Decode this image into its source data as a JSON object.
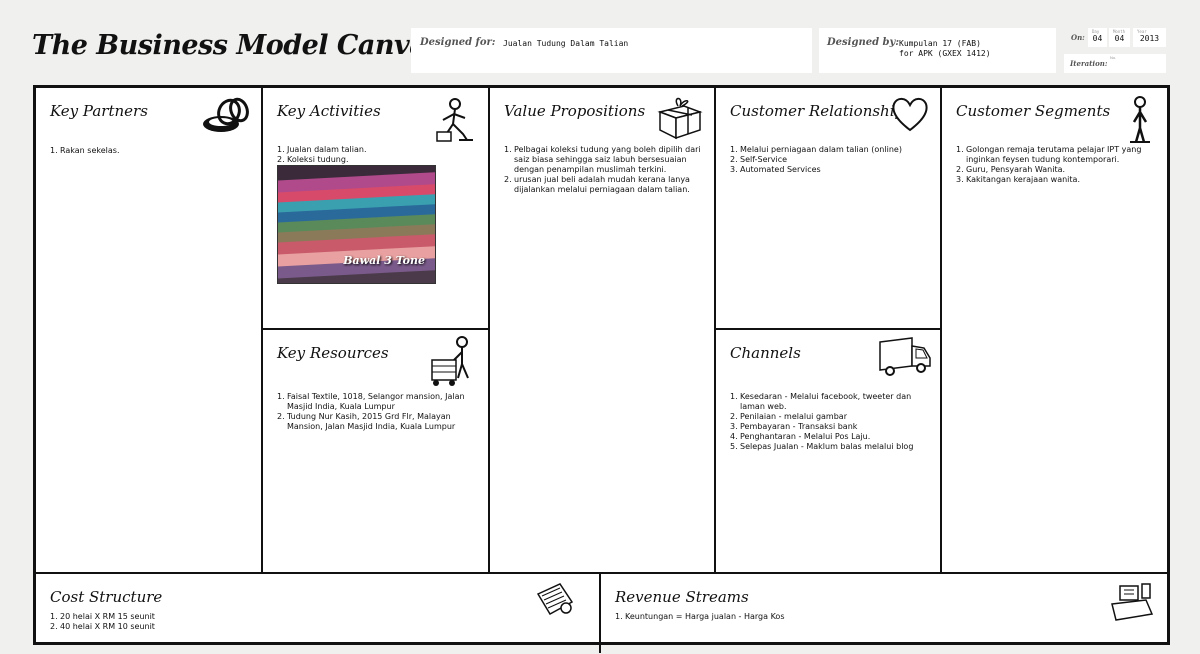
{
  "header": {
    "title": "The Business Model Canvas",
    "designed_for_label": "Designed for:",
    "designed_for_value": "Jualan Tudung Dalam Talian",
    "designed_by_label": "Designed by:",
    "designed_by_line1": "Kumpulan 17 (FAB)",
    "designed_by_line2": "for APK (GXEX 1412)",
    "on_label": "On:",
    "date_day_cap": "Day",
    "date_day": "04",
    "date_month_cap": "Month",
    "date_month": "04",
    "date_year_cap": "Year",
    "date_year": "2013",
    "iteration_label": "Iteration:",
    "iteration_cap": "No."
  },
  "sections": {
    "key_partners": {
      "title": "Key Partners",
      "icon": "chain-link-icon",
      "items": [
        "Rakan sekelas."
      ]
    },
    "key_activities": {
      "title": "Key Activities",
      "icon": "worker-icon",
      "items": [
        "Jualan dalam talian.",
        "Koleksi tudung."
      ],
      "photo_caption": "Bawal 3 Tone"
    },
    "key_resources": {
      "title": "Key Resources",
      "icon": "person-with-crate-icon",
      "items": [
        "Faisal Textile, 1018, Selangor mansion, Jalan Masjid India, Kuala Lumpur",
        "Tudung Nur Kasih, 2015 Grd Flr, Malayan Mansion, Jalan Masjid India, Kuala Lumpur"
      ]
    },
    "value_propositions": {
      "title": "Value Propositions",
      "icon": "gift-box-icon",
      "items": [
        "Pelbagai koleksi tudung yang boleh dipilih dari saiz biasa sehingga saiz labuh bersesuaian dengan penampilan muslimah terkini.",
        "urusan jual beli adalah mudah kerana lanya dijalankan melalui perniagaan dalam talian."
      ]
    },
    "customer_relationships": {
      "title": "Customer Relationships",
      "icon": "heart-icon",
      "items": [
        "Melalui perniagaan dalam talian (online)",
        "Self-Service",
        "Automated Services"
      ]
    },
    "channels": {
      "title": "Channels",
      "icon": "truck-icon",
      "items": [
        "Kesedaran - Melalui facebook, tweeter dan laman web.",
        "Penilaian - melalui gambar",
        "Pembayaran - Transaksi bank",
        "Penghantaran - Melalui Pos Laju.",
        "Selepas Jualan - Maklum balas melalui blog"
      ]
    },
    "customer_segments": {
      "title": "Customer Segments",
      "icon": "standing-person-icon",
      "items": [
        "Golongan remaja terutama pelajar IPT yang inginkan feysen tudung kontemporari.",
        "Guru, Pensyarah Wanita.",
        "Kakitangan kerajaan wanita."
      ]
    },
    "cost_structure": {
      "title": "Cost Structure",
      "icon": "price-tag-icon",
      "items": [
        "20 helai X RM 15 seunit",
        "40 helai X RM 10 seunit"
      ]
    },
    "revenue_streams": {
      "title": "Revenue Streams",
      "icon": "cash-register-icon",
      "items": [
        "Keuntungan = Harga jualan - Harga Kos"
      ]
    }
  }
}
